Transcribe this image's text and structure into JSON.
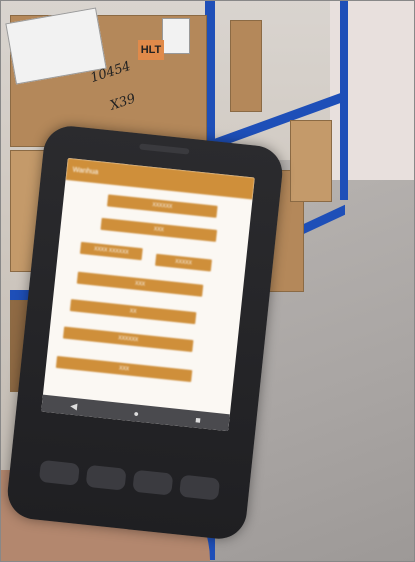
{
  "scene": {
    "description_tag": "warehouse-photo",
    "box_label": "HLT",
    "handwritten_number": "10454",
    "handwritten_qty": "X39"
  },
  "device": {
    "app_title": "Wanhua",
    "buttons": [
      {
        "label": "XXXXXX"
      },
      {
        "label": "XXX"
      },
      {
        "label": "XXXX XXXXXX"
      },
      {
        "label": "XXXXX"
      },
      {
        "label": "XXX"
      },
      {
        "label": "XX"
      },
      {
        "label": "XXXXXX"
      },
      {
        "label": "XXX"
      }
    ],
    "nav": {
      "back": "◀",
      "home": "●",
      "recent": "■"
    }
  },
  "colors": {
    "shelf": "#1e4fb8",
    "app_accent": "#cf8f3a",
    "device_body": "#2b2b2e"
  }
}
